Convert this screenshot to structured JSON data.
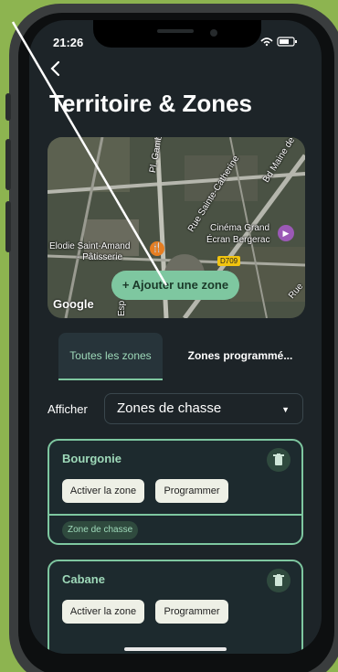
{
  "status": {
    "time": "21:26",
    "indicators": "•• ▾ ▮"
  },
  "header": {
    "back_icon": "chevron-left-icon",
    "title": "Territoire & Zones"
  },
  "map": {
    "labels": [
      "Pl. Gambetta",
      "Rue Sainte-Catherine",
      "Bd Maine de",
      "Cinéma Grand",
      "Écran Bergerac",
      "Elodie Saint-Amand",
      "- Pâtisserie",
      "D709",
      "Rue",
      "Esp"
    ],
    "attribution": "Google",
    "add_zone_label": "+ Ajouter une zone"
  },
  "tabs": {
    "all_zones": "Toutes les zones",
    "scheduled_zones": "Zones programmé..."
  },
  "filter": {
    "label": "Afficher",
    "value": "Zones de chasse"
  },
  "zones": [
    {
      "name": "Bourgonie",
      "activate_label": "Activer la zone",
      "schedule_label": "Programmer",
      "tag": "Zone de chasse"
    },
    {
      "name": "Cabane",
      "activate_label": "Activer la zone",
      "schedule_label": "Programmer"
    }
  ],
  "colors": {
    "accent": "#7ec7a0",
    "background": "#1d2428",
    "page_bg": "#8db450"
  }
}
